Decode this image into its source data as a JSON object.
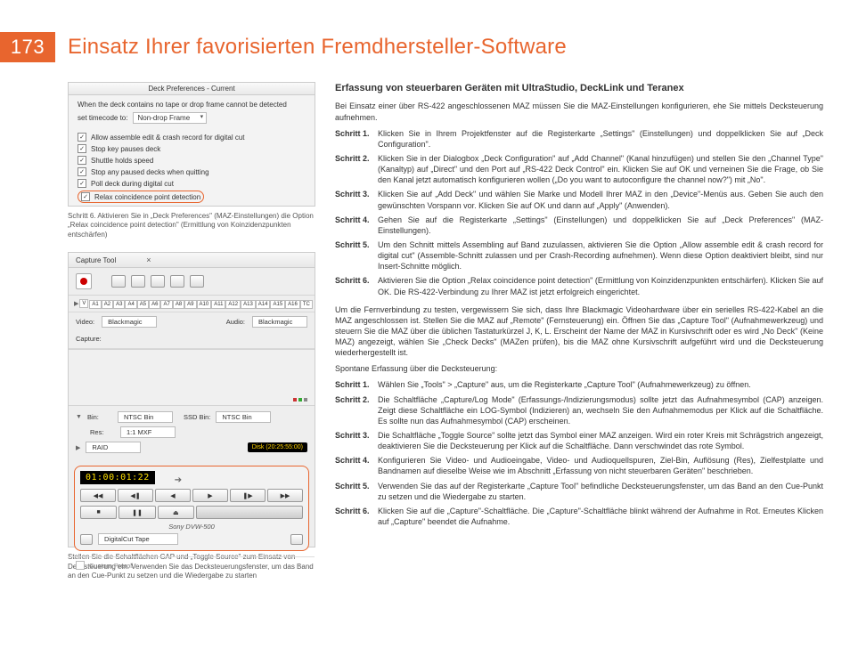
{
  "page_number": "173",
  "page_title": "Einsatz Ihrer favorisierten Fremdhersteller-Software",
  "fig1": {
    "title": "Deck Preferences - Current",
    "line1": "When the deck contains no tape or drop frame cannot be detected",
    "set_label": "set timecode to:",
    "combo": "Non-drop Frame",
    "checks": [
      "Allow assemble edit & crash record for digital cut",
      "Stop key pauses deck",
      "Shuttle holds speed",
      "Stop any paused decks when quitting",
      "Poll deck during digital cut",
      "Relax coincidence point detection"
    ],
    "caption": "Schritt 6. Aktivieren Sie in „Deck Preferences\" (MAZ-Einstellungen) die Option „Relax coincidence point detection\" (Ermittlung von Koinzidenzpunkten entschärfen)"
  },
  "fig2": {
    "title": "Capture Tool",
    "v_label": "V",
    "tracks": [
      "A1",
      "A2",
      "A3",
      "A4",
      "A5",
      "A6",
      "A7",
      "A8",
      "A9",
      "A10",
      "A11",
      "A12",
      "A13",
      "A14",
      "A15",
      "A16",
      "TC"
    ],
    "video_label": "Video:",
    "video_val": "Blackmagic",
    "audio_label": "Audio:",
    "audio_val": "Blackmagic",
    "capture_label": "Capture:",
    "bin_label": "Bin:",
    "bin_val": "NTSC Bin",
    "ssd_label": "SSD Bin:",
    "ssd_val": "NTSC Bin",
    "res_label": "Res:",
    "res_val": "1:1 MXF",
    "raid_label": "RAID",
    "disk": "Disk (20:25:55:00)",
    "timecode": "01:00:01:22",
    "deck_name": "Sony DVW-500",
    "tape_label": "DigitalCut Tape",
    "preroll": "Custom Preroll",
    "caption": "Stellen Sie die Schaltflächen CAP und „Toggle Source\" zum Einsatz von Decksteuerung ein. Verwenden Sie das Decksteuerungsfenster, um das Band an den Cue-Punkt zu setzen und die Wiedergabe zu starten"
  },
  "right": {
    "heading": "Erfassung von steuerbaren Geräten mit UltraStudio, DeckLink und Teranex",
    "intro": "Bei Einsatz einer über RS-422 angeschlossenen MAZ müssen Sie die MAZ-Einstellungen konfigurieren, ehe Sie mittels Decksteuerung aufnehmen.",
    "steps1": [
      {
        "n": "Schritt 1.",
        "t": "Klicken Sie in Ihrem Projektfenster auf die Registerkarte „Settings\" (Einstellungen) und doppelklicken Sie auf „Deck Configuration\"."
      },
      {
        "n": "Schritt 2.",
        "t": "Klicken Sie in der Dialogbox „Deck Configuration\" auf „Add Channel\" (Kanal hinzufügen) und stellen Sie den „Channel Type\" (Kanaltyp) auf „Direct\" und den Port auf „RS-422 Deck Control\" ein. Klicken Sie auf OK und verneinen Sie die Frage, ob Sie den Kanal jetzt automatisch konfigurieren wollen („Do you want to autoconfigure the channel now?\") mit „No\"."
      },
      {
        "n": "Schritt 3.",
        "t": "Klicken Sie auf „Add Deck\" und wählen Sie Marke und Modell Ihrer MAZ in den „Device\"-Menüs aus. Geben Sie auch den gewünschten Vorspann vor. Klicken Sie auf OK und dann auf „Apply\" (Anwenden)."
      },
      {
        "n": "Schritt 4.",
        "t": "Gehen Sie auf die Registerkarte „Settings\" (Einstellungen) und doppelklicken Sie auf „Deck Preferences\" (MAZ-Einstellungen)."
      },
      {
        "n": "Schritt 5.",
        "t": "Um den Schnitt mittels Assembling auf Band zuzulassen, aktivieren Sie die Option „Allow assemble edit & crash record for digital cut\" (Assemble-Schnitt zulassen und per Crash-Recording aufnehmen). Wenn diese Option deaktiviert bleibt, sind nur Insert-Schnitte möglich."
      },
      {
        "n": "Schritt 6.",
        "t": "Aktivieren Sie die Option „Relax coincidence point detection\" (Ermittlung von Koinzidenzpunkten entschärfen). Klicken Sie auf OK. Die RS-422-Verbindung zu Ihrer MAZ ist jetzt erfolgreich eingerichtet."
      }
    ],
    "mid1": "Um die Fernverbindung zu testen, vergewissern Sie sich, dass Ihre Blackmagic Videohardware über ein serielles RS-422-Kabel an die MAZ angeschlossen ist. Stellen Sie die MAZ auf „Remote\" (Fernsteuerung) ein. Öffnen Sie das „Capture Tool\" (Aufnahmewerkzeug) und steuern Sie die MAZ über die üblichen Tastaturkürzel J, K, L. Erscheint der Name der MAZ in Kursivschrift oder es wird „No Deck\" (Keine MAZ) angezeigt, wählen Sie „Check Decks\" (MAZen prüfen), bis die MAZ ohne Kursivschrift aufgeführt wird und die Decksteuerung wiederhergestellt ist.",
    "mid2": "Spontane Erfassung über die Decksteuerung:",
    "steps2": [
      {
        "n": "Schritt 1.",
        "t": "Wählen Sie „Tools\" > „Capture\" aus, um die Registerkarte „Capture Tool\" (Aufnahmewerkzeug) zu öffnen."
      },
      {
        "n": "Schritt 2.",
        "t": "Die Schaltfläche „Capture/Log Mode\" (Erfassungs-/Indizierungsmodus) sollte jetzt das Aufnahmesymbol (CAP) anzeigen. Zeigt diese Schaltfläche ein LOG-Symbol (Indizieren) an, wechseln Sie den Aufnahmemodus per Klick auf die Schaltfläche. Es sollte nun das Aufnahmesymbol (CAP) erscheinen."
      },
      {
        "n": "Schritt 3.",
        "t": "Die Schaltfläche „Toggle Source\" sollte jetzt das Symbol einer MAZ anzeigen. Wird ein roter Kreis mit Schrägstrich angezeigt, deaktivieren Sie die Decksteuerung per Klick auf die Schaltfläche. Dann verschwindet das rote Symbol."
      },
      {
        "n": "Schritt 4.",
        "t": "Konfigurieren Sie Video- und Audioeingabe, Video- und Audioquellspuren, Ziel-Bin, Auflösung (Res), Zielfestplatte und Bandnamen auf dieselbe Weise wie im Abschnitt „Erfassung von nicht steuerbaren Geräten\" beschrieben."
      },
      {
        "n": "Schritt 5.",
        "t": "Verwenden Sie das auf der Registerkarte „Capture Tool\" befindliche Decksteuerungsfenster, um das Band an den Cue-Punkt zu setzen und die Wiedergabe zu starten."
      },
      {
        "n": "Schritt 6.",
        "t": "Klicken Sie auf die „Capture\"-Schaltfläche. Die „Capture\"-Schaltfläche blinkt während der Aufnahme in Rot. Erneutes Klicken auf „Capture\" beendet die Aufnahme."
      }
    ]
  }
}
